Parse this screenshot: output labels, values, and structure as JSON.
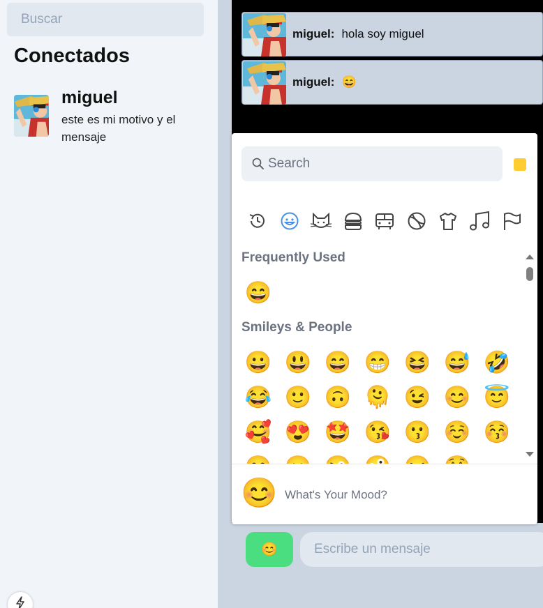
{
  "sidebar": {
    "search_placeholder": "Buscar",
    "title": "Conectados",
    "contacts": [
      {
        "name": "miguel",
        "status": "este es mi motivo y el mensaje",
        "avatar_icon": "avatar-straw-hat-icon"
      }
    ]
  },
  "chat": {
    "messages": [
      {
        "author": "miguel:",
        "text": "hola soy miguel"
      },
      {
        "author": "miguel:",
        "text": "😄"
      }
    ],
    "input_placeholder": "Escribe un mensaje",
    "emoji_button_label": "😊"
  },
  "emoji_picker": {
    "search_placeholder": "Search",
    "skin_tone_color": "#ffcd32",
    "categories": [
      "recent-icon",
      "smiley-icon",
      "cat-icon",
      "burger-icon",
      "bus-icon",
      "ball-icon",
      "shirt-icon",
      "music-icon",
      "flag-icon"
    ],
    "active_category": "smiley-icon",
    "accent_color": "#4a90e2",
    "frequently_used_title": "Frequently Used",
    "frequently_used": [
      "😄"
    ],
    "smileys_title": "Smileys & People",
    "smileys": [
      "😀",
      "😃",
      "😄",
      "😁",
      "😆",
      "😅",
      "🤣",
      "😂",
      "🙂",
      "🙃",
      "🫠",
      "😉",
      "😊",
      "😇",
      "🥰",
      "😍",
      "🤩",
      "😘",
      "😗",
      "☺️",
      "😚",
      "😋",
      "😛",
      "😜",
      "🤪",
      "😝",
      "🤑"
    ],
    "footer_preview": "😊",
    "footer_text": "What's Your Mood?"
  },
  "colors": {
    "sidebar_bg": "#f1f5f9",
    "chat_bg": "#cbd5e1",
    "send_button": "#4ade80"
  }
}
